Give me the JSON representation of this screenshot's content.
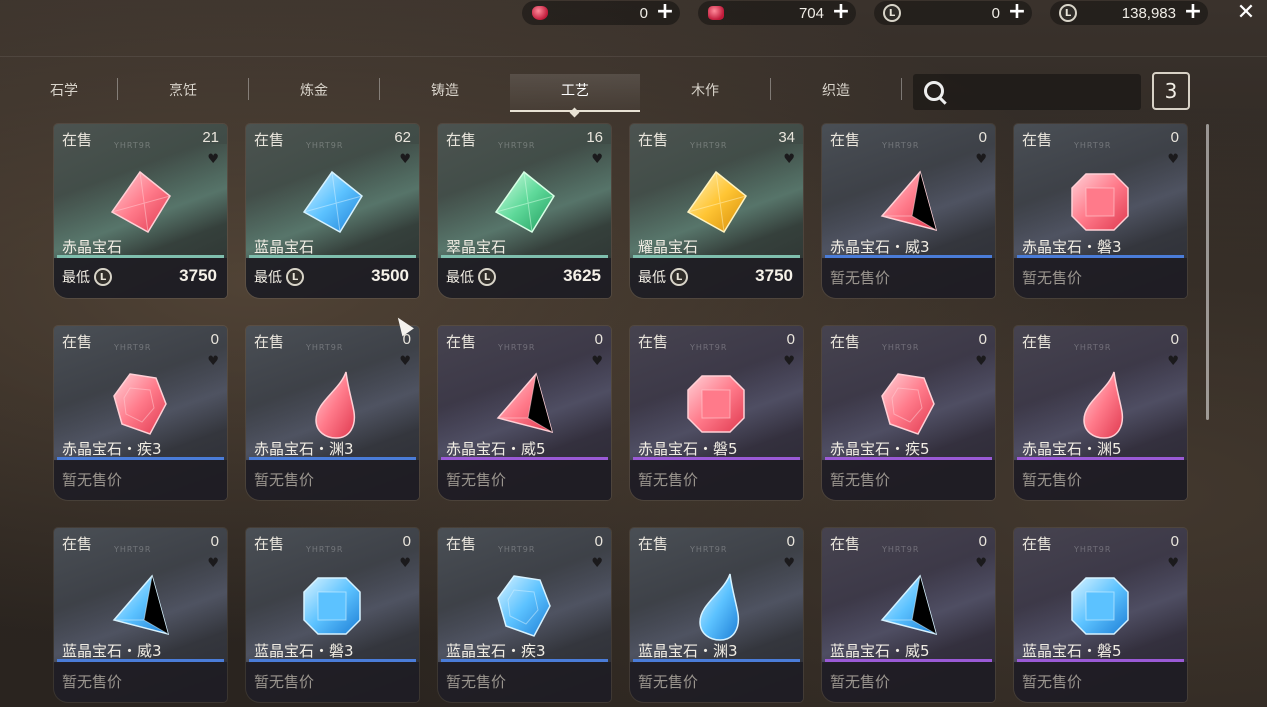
{
  "currencies": [
    {
      "icon": "red-gem-icon",
      "value": "0"
    },
    {
      "icon": "red-crystal-icon",
      "value": "704"
    },
    {
      "icon": "coin-icon",
      "value": "0"
    },
    {
      "icon": "coin-icon",
      "value": "138,983"
    }
  ],
  "tabs": [
    "石学",
    "烹饪",
    "炼金",
    "铸造",
    "工艺",
    "木作",
    "织造"
  ],
  "active_tab": "工艺",
  "search": {
    "placeholder": ""
  },
  "result_count": "3",
  "labels": {
    "on_sale": "在售",
    "lowest": "最低",
    "no_price": "暂无售价",
    "watermark": "YHRT9R"
  },
  "cards": [
    {
      "name": "赤晶宝石",
      "count": "21",
      "price": "3750",
      "gem": "red-diamond",
      "line": "#7fbfae",
      "theme": "top-green"
    },
    {
      "name": "蓝晶宝石",
      "count": "62",
      "price": "3500",
      "gem": "blue-diamond",
      "line": "#7fbfae",
      "theme": "top-green"
    },
    {
      "name": "翠晶宝石",
      "count": "16",
      "price": "3625",
      "gem": "green-diamond",
      "line": "#7fbfae",
      "theme": "top-green"
    },
    {
      "name": "耀晶宝石",
      "count": "34",
      "price": "3750",
      "gem": "gold-diamond",
      "line": "#7fbfae",
      "theme": "top-green"
    },
    {
      "name": "赤晶宝石・威3",
      "count": "0",
      "price": "",
      "gem": "red-triangle",
      "line": "#4a7cd8",
      "theme": "blue"
    },
    {
      "name": "赤晶宝石・磐3",
      "count": "0",
      "price": "",
      "gem": "red-octagon",
      "line": "#4a7cd8",
      "theme": "blue"
    },
    {
      "name": "赤晶宝石・疾3",
      "count": "0",
      "price": "",
      "gem": "red-shield",
      "line": "#4a7cd8",
      "theme": "blue"
    },
    {
      "name": "赤晶宝石・渊3",
      "count": "0",
      "price": "",
      "gem": "red-drop",
      "line": "#4a7cd8",
      "theme": "blue"
    },
    {
      "name": "赤晶宝石・威5",
      "count": "0",
      "price": "",
      "gem": "red-triangle",
      "line": "#9a5ad6",
      "theme": "purple"
    },
    {
      "name": "赤晶宝石・磐5",
      "count": "0",
      "price": "",
      "gem": "red-octagon",
      "line": "#9a5ad6",
      "theme": "purple"
    },
    {
      "name": "赤晶宝石・疾5",
      "count": "0",
      "price": "",
      "gem": "red-shield",
      "line": "#9a5ad6",
      "theme": "purple"
    },
    {
      "name": "赤晶宝石・渊5",
      "count": "0",
      "price": "",
      "gem": "red-drop",
      "line": "#9a5ad6",
      "theme": "purple"
    },
    {
      "name": "蓝晶宝石・威3",
      "count": "0",
      "price": "",
      "gem": "blue-triangle",
      "line": "#4a7cd8",
      "theme": "blue"
    },
    {
      "name": "蓝晶宝石・磐3",
      "count": "0",
      "price": "",
      "gem": "blue-octagon",
      "line": "#4a7cd8",
      "theme": "blue"
    },
    {
      "name": "蓝晶宝石・疾3",
      "count": "0",
      "price": "",
      "gem": "blue-shield",
      "line": "#4a7cd8",
      "theme": "blue"
    },
    {
      "name": "蓝晶宝石・渊3",
      "count": "0",
      "price": "",
      "gem": "blue-drop",
      "line": "#4a7cd8",
      "theme": "blue"
    },
    {
      "name": "蓝晶宝石・威5",
      "count": "0",
      "price": "",
      "gem": "blue-triangle",
      "line": "#9a5ad6",
      "theme": "purple"
    },
    {
      "name": "蓝晶宝石・磐5",
      "count": "0",
      "price": "",
      "gem": "blue-octagon",
      "line": "#9a5ad6",
      "theme": "purple"
    }
  ]
}
